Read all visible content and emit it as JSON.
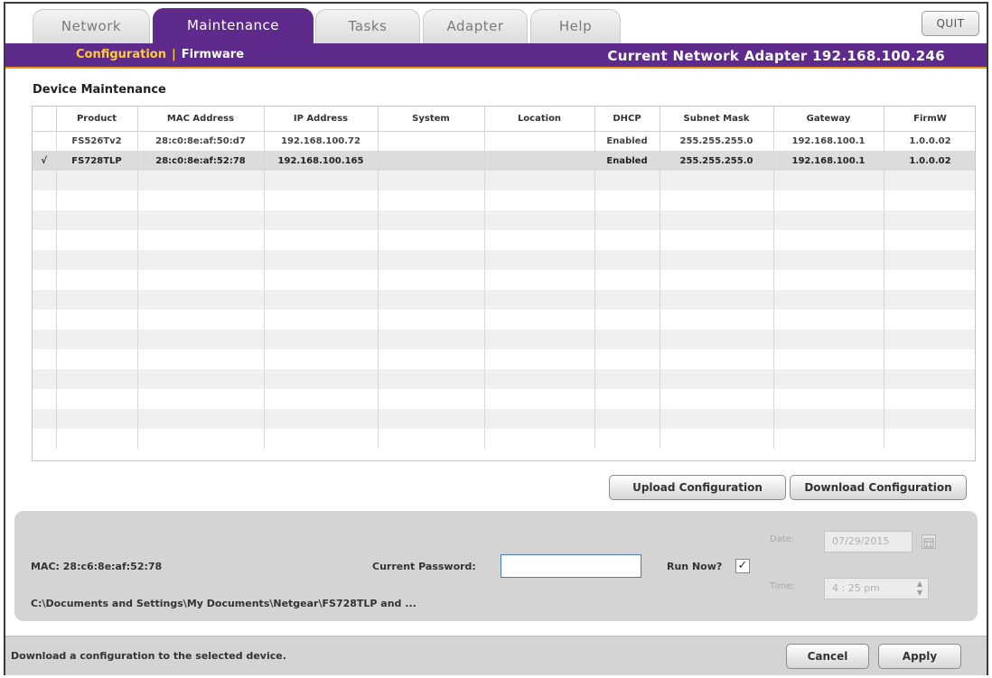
{
  "tabs": [
    {
      "label": "Network"
    },
    {
      "label": "Maintenance"
    },
    {
      "label": "Tasks"
    },
    {
      "label": "Adapter"
    },
    {
      "label": "Help"
    }
  ],
  "quit_label": "QUIT",
  "subnav": {
    "configuration": "Configuration",
    "separator": "|",
    "firmware": "Firmware",
    "adapter_text": "Current Network Adapter 192.168.100.246"
  },
  "section_title": "Device Maintenance",
  "table": {
    "columns": [
      "",
      "Product",
      "MAC Address",
      "IP Address",
      "System",
      "Location",
      "DHCP",
      "Subnet Mask",
      "Gateway",
      "FirmW"
    ],
    "rows": [
      {
        "check": "",
        "product": "FS526Tv2",
        "mac": "28:c0:8e:af:50:d7",
        "ip": "192.168.100.72",
        "system": "",
        "location": "",
        "dhcp": "Enabled",
        "subnet": "255.255.255.0",
        "gateway": "192.168.100.1",
        "firmware": "1.0.0.02"
      },
      {
        "check": "√",
        "product": "FS728TLP",
        "mac": "28:c0:8e:af:52:78",
        "ip": "192.168.100.165",
        "system": "",
        "location": "",
        "dhcp": "Enabled",
        "subnet": "255.255.255.0",
        "gateway": "192.168.100.1",
        "firmware": "1.0.0.02"
      }
    ]
  },
  "buttons": {
    "upload": "Upload Configuration",
    "download": "Download Configuration",
    "cancel": "Cancel",
    "apply": "Apply"
  },
  "panel": {
    "mac_label": "MAC: 28:c6:8e:af:52:78",
    "password_label": "Current Password:",
    "password_value": "",
    "run_now_label": "Run Now?",
    "run_now_checked": "✓",
    "date_label": "Date:",
    "date_value": "07/29/2015",
    "time_label": "Time:",
    "time_value": "4 : 25   pm",
    "path": "C:\\Documents and Settings\\My Documents\\Netgear\\FS728TLP and ..."
  },
  "status_text": "Download a configuration to the selected device.",
  "colors": {
    "accent": "#5e2a8c",
    "highlight": "#ffcc33",
    "underline": "#f09a1a"
  }
}
